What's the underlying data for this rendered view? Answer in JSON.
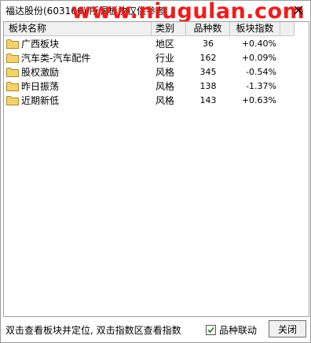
{
  "window": {
    "title": "福达股份(603166) 所属板块仅供参考",
    "watermark": "www.niugulan.com",
    "close_glyph": "✕"
  },
  "table": {
    "headers": [
      "板块名称",
      "类别",
      "品种数",
      "板块指数"
    ],
    "rows": [
      {
        "name": "广西板块",
        "type": "地区",
        "count": "36",
        "change": "+0.40%"
      },
      {
        "name": "汽车类-汽车配件",
        "type": "行业",
        "count": "162",
        "change": "+0.09%"
      },
      {
        "name": "股权激励",
        "type": "风格",
        "count": "345",
        "change": "-0.54%"
      },
      {
        "name": "昨日振荡",
        "type": "风格",
        "count": "138",
        "change": "-1.37%"
      },
      {
        "name": "近期新低",
        "type": "风格",
        "count": "143",
        "change": "+0.63%"
      }
    ],
    "row_icon": "folder-icon"
  },
  "statusbar": {
    "hint": "双击查看板块并定位, 双击指数区查看指数",
    "checkbox_label": "品种联动",
    "checkbox_checked": true,
    "close_button": "关闭"
  },
  "colors": {
    "watermark": "#ee1d1d",
    "folder": "#f3d36b",
    "checkmark": "#1a7f1a"
  }
}
